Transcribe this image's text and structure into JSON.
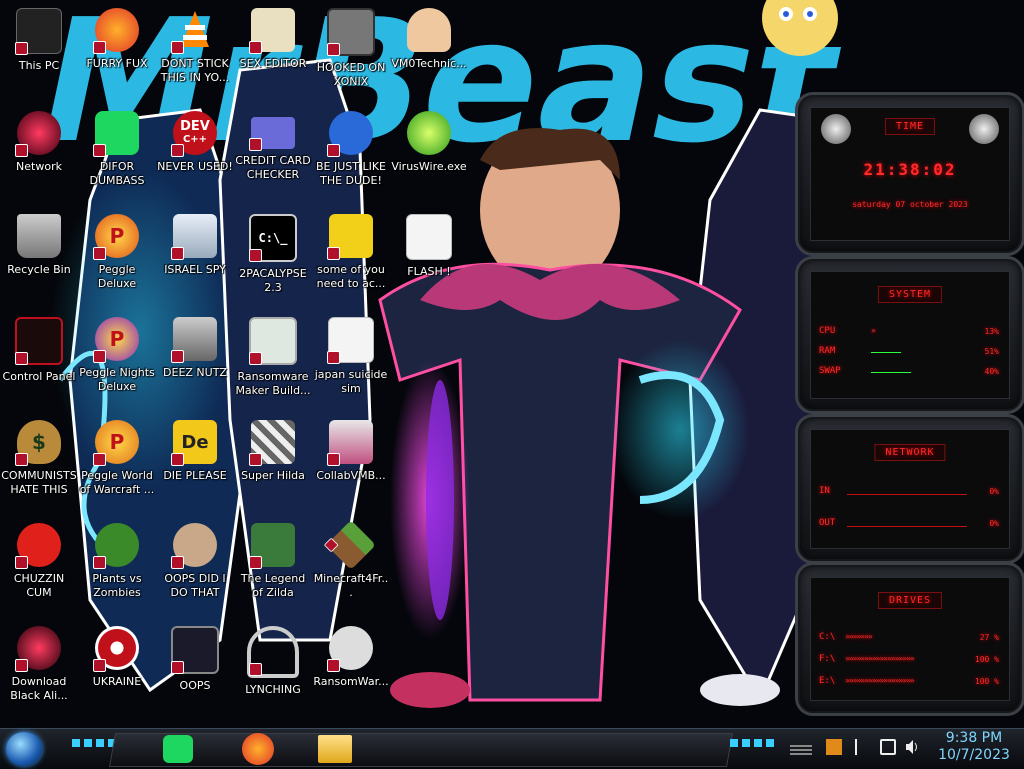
{
  "desktop": {
    "icons": [
      {
        "label": "This PC"
      },
      {
        "label": "FURRY FUX"
      },
      {
        "label": "DONT STICK THIS IN YO..."
      },
      {
        "label": "SEX EDITOR"
      },
      {
        "label": "HOOKED ON XONIX"
      },
      {
        "label": "VM0Technic..."
      },
      {
        "label": "Network"
      },
      {
        "label": "DIFOR DUMBASS"
      },
      {
        "label": "NEVER USED!"
      },
      {
        "label": "CREDIT CARD CHECKER"
      },
      {
        "label": "BE JUST LIKE THE DUDE!"
      },
      {
        "label": "VirusWire.exe"
      },
      {
        "label": "Recycle Bin"
      },
      {
        "label": "Peggle Deluxe"
      },
      {
        "label": "ISRAEL SPY"
      },
      {
        "label": "2PACALYPSE 2.3"
      },
      {
        "label": "some of you need to ac..."
      },
      {
        "label": "FLASH !"
      },
      {
        "label": "Control Panel"
      },
      {
        "label": "Peggle Nights Deluxe"
      },
      {
        "label": "DEEZ NUTZ"
      },
      {
        "label": "Ransomware Maker Build..."
      },
      {
        "label": "japan suicide sim"
      },
      {
        "label": "COMMUNISTS HATE THIS G..."
      },
      {
        "label": "Peggle World of Warcraft ..."
      },
      {
        "label": "DIE PLEASE"
      },
      {
        "label": "Super Hilda"
      },
      {
        "label": "CollabVMB..."
      },
      {
        "label": "CHUZZIN CUM"
      },
      {
        "label": "Plants vs Zombies"
      },
      {
        "label": "OOPS DID I DO THAT"
      },
      {
        "label": "The Legend of Zilda"
      },
      {
        "label": "Minecraft4Fr..."
      },
      {
        "label": "Download Black Ali..."
      },
      {
        "label": "UKRAINE"
      },
      {
        "label": "OOPS"
      },
      {
        "label": "LYNCHING"
      },
      {
        "label": "RansomWar..."
      }
    ],
    "icon_glyphs": {
      "dev": "DEV",
      "dev_sub": "C++",
      "die": "De",
      "p": "P",
      "cmd": "C:\\_"
    },
    "wallpaper_text": "MrBeast"
  },
  "widgets": {
    "time": {
      "title": "TIME",
      "clock": "21:38:02",
      "date": "saturday 07 october 2023"
    },
    "system": {
      "title": "SYSTEM",
      "rows": [
        {
          "label": "CPU",
          "value": "13%"
        },
        {
          "label": "RAM",
          "value": "51%"
        },
        {
          "label": "SWAP",
          "value": "40%"
        }
      ]
    },
    "network": {
      "title": "NETWORK",
      "rows": [
        {
          "label": "IN",
          "value": "0%"
        },
        {
          "label": "OUT",
          "value": "0%"
        }
      ]
    },
    "drives": {
      "title": "DRIVES",
      "rows": [
        {
          "label": "C:\\",
          "value": "27 %"
        },
        {
          "label": "F:\\",
          "value": "100 %"
        },
        {
          "label": "E:\\",
          "value": "100 %"
        }
      ]
    }
  },
  "taskbar": {
    "clock_time": "9:38 PM",
    "clock_date": "10/7/2023",
    "pinned": [
      "Spotify",
      "Firefox",
      "File Explorer"
    ],
    "tray": [
      "orientation-icon",
      "flag-icon",
      "network-icon",
      "volume-icon"
    ]
  },
  "colors": {
    "accent_red": "#ff2a2a",
    "wallpaper_cyan": "#2ec3ef",
    "taskbar_clock": "#7fd6ff"
  }
}
